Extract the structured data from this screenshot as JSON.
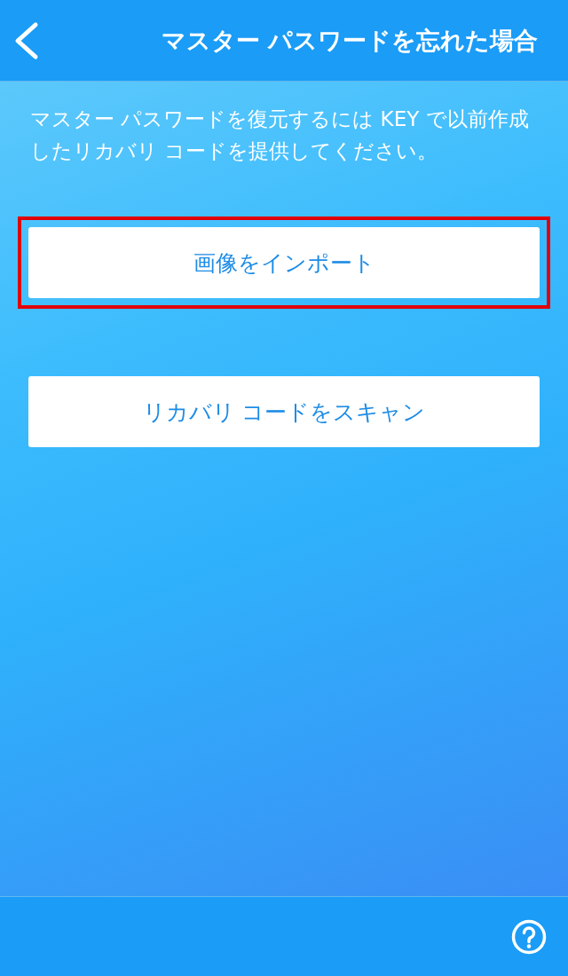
{
  "header": {
    "title": "マスター パスワードを忘れた場合"
  },
  "description": "マスター パスワードを復元するには KEY で以前作成したリカバリ コードを提供してください。",
  "buttons": [
    {
      "label": "画像をインポート",
      "highlighted": true
    },
    {
      "label": "リカバリ コードをスキャン",
      "highlighted": false
    }
  ]
}
